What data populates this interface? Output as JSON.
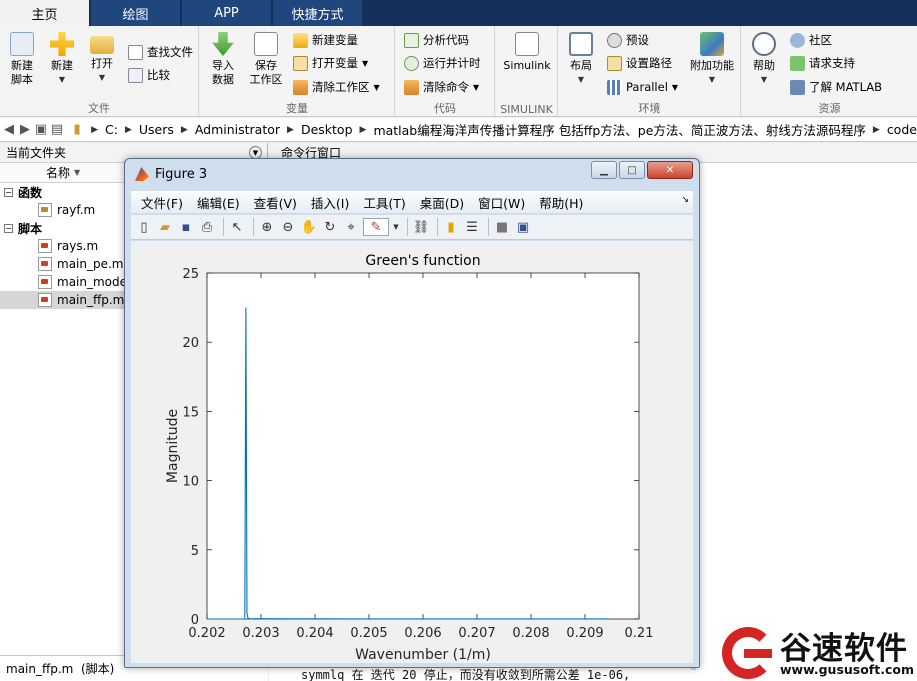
{
  "tabs": [
    {
      "label": "主页",
      "active": true
    },
    {
      "label": "绘图",
      "active": false
    },
    {
      "label": "APP",
      "active": false
    },
    {
      "label": "快捷方式",
      "active": false
    }
  ],
  "ribbon": {
    "file": {
      "label": "文件",
      "new_script": "新建\n脚本",
      "new": "新建",
      "open": "打开",
      "find_files": "查找文件",
      "compare": "比较"
    },
    "variable": {
      "label": "变量",
      "import": "导入\n数据",
      "save_ws": "保存\n工作区",
      "new_var": "新建变量",
      "open_var": "打开变量",
      "clear_ws": "清除工作区"
    },
    "code": {
      "label": "代码",
      "analyze": "分析代码",
      "run_time": "运行并计时",
      "clear_cmd": "清除命令"
    },
    "simulink": {
      "label": "SIMULINK",
      "button": "Simulink"
    },
    "env": {
      "label": "环境",
      "layout": "布局",
      "prefs": "预设",
      "set_path": "设置路径",
      "parallel": "Parallel",
      "addons": "附加功能"
    },
    "resources": {
      "label": "资源",
      "help": "帮助",
      "community": "社区",
      "support": "请求支持",
      "learn": "了解 MATLAB"
    }
  },
  "address": {
    "segments": [
      "C:",
      "Users",
      "Administrator",
      "Desktop",
      "matlab编程海洋声传播计算程序 包括ffp方法、pe方法、简正波方法、射线方法源码程序",
      "code"
    ]
  },
  "file_panel": {
    "title": "当前文件夹",
    "column_name": "名称",
    "groups": [
      {
        "label": "函数",
        "files": [
          {
            "name": "rayf.m",
            "selected": false
          }
        ]
      },
      {
        "label": "脚本",
        "files": [
          {
            "name": "rays.m",
            "selected": false
          },
          {
            "name": "main_pe.m",
            "selected": false
          },
          {
            "name": "main_mode",
            "selected": false
          },
          {
            "name": "main_ffp.m",
            "selected": true
          }
        ]
      }
    ],
    "status": "main_ffp.m  (脚本)"
  },
  "command_window": {
    "title": "命令行窗口",
    "last_line": "symmlq 在 迭代 20 停止，而没有收敛到所需公差 1e-06,"
  },
  "figure": {
    "title": "Figure 3",
    "menu": [
      "文件(F)",
      "编辑(E)",
      "查看(V)",
      "插入(I)",
      "工具(T)",
      "桌面(D)",
      "窗口(W)",
      "帮助(H)"
    ],
    "toolbar_icons": [
      "new-figure-icon",
      "open-file-icon",
      "save-icon",
      "print-icon",
      "pointer-icon",
      "zoom-in-icon",
      "zoom-out-icon",
      "pan-icon",
      "rotate-icon",
      "data-cursor-icon",
      "brush-icon",
      "link-plot-icon",
      "colorbar-icon",
      "legend-icon",
      "hide-plot-tools-icon",
      "show-plot-tools-icon"
    ]
  },
  "chart_data": {
    "type": "line",
    "title": "Green's function",
    "xlabel": "Wavenumber (1/m)",
    "ylabel": "Magnitude",
    "xlim": [
      0.202,
      0.21
    ],
    "ylim": [
      0,
      25
    ],
    "xticks": [
      "0.202",
      "0.203",
      "0.204",
      "0.205",
      "0.206",
      "0.207",
      "0.208",
      "0.209",
      "0.21"
    ],
    "yticks": [
      "0",
      "5",
      "10",
      "15",
      "20",
      "25"
    ],
    "color": "#0072BD",
    "series": [
      {
        "x": [
          0.202,
          0.2027,
          0.20272,
          0.20274,
          0.20276,
          0.2028,
          0.2035,
          0.205,
          0.207,
          0.2094
        ],
        "y": [
          0,
          0.0,
          22.5,
          0.4,
          0.05,
          0.02,
          0.01,
          0.005,
          0.003,
          0.002
        ]
      }
    ]
  },
  "watermark": {
    "cn": "谷速软件",
    "url": "www.gususoft.com"
  }
}
